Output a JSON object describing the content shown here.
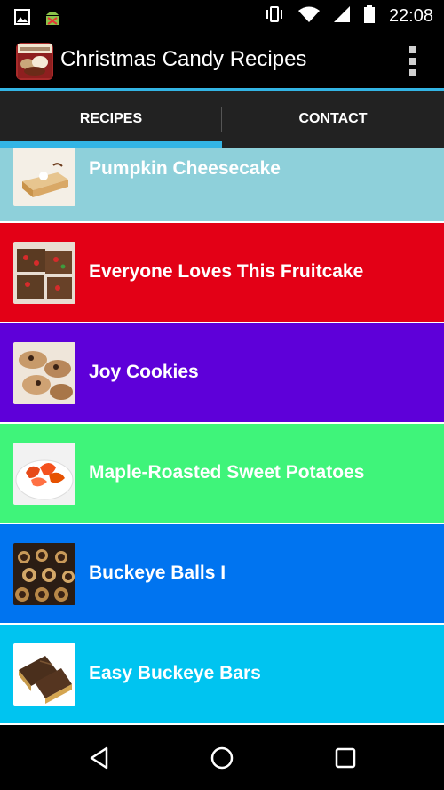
{
  "status_bar": {
    "time": "22:08",
    "icons_left": [
      "image-icon",
      "android-debug-icon"
    ],
    "icons_right": [
      "vibrate-icon",
      "wifi-icon",
      "signal-icon",
      "battery-icon"
    ]
  },
  "action_bar": {
    "app_icon_text": "Christmas Candy Recipes",
    "title": "Christmas Candy Recipes",
    "overflow_icon": "overflow-menu-icon"
  },
  "tabs": [
    {
      "label": "RECIPES",
      "selected": true
    },
    {
      "label": "CONTACT",
      "selected": false
    }
  ],
  "colors": {
    "accent": "#33b5e5",
    "row_colors": [
      "#8ed0da",
      "#e30016",
      "#5e00d9",
      "#3ff47a",
      "#0074f0",
      "#00c4f0"
    ]
  },
  "recipes": [
    {
      "title": "Pumpkin Cheesecake",
      "color": "#8ed0da"
    },
    {
      "title": "Everyone Loves This Fruitcake",
      "color": "#e30016"
    },
    {
      "title": "Joy Cookies",
      "color": "#5e00d9"
    },
    {
      "title": "Maple-Roasted Sweet Potatoes",
      "color": "#3ff47a"
    },
    {
      "title": "Buckeye Balls I",
      "color": "#0074f0"
    },
    {
      "title": "Easy Buckeye Bars",
      "color": "#00c4f0"
    }
  ],
  "nav_bar": {
    "buttons": [
      "back-icon",
      "home-icon",
      "recents-icon"
    ]
  }
}
